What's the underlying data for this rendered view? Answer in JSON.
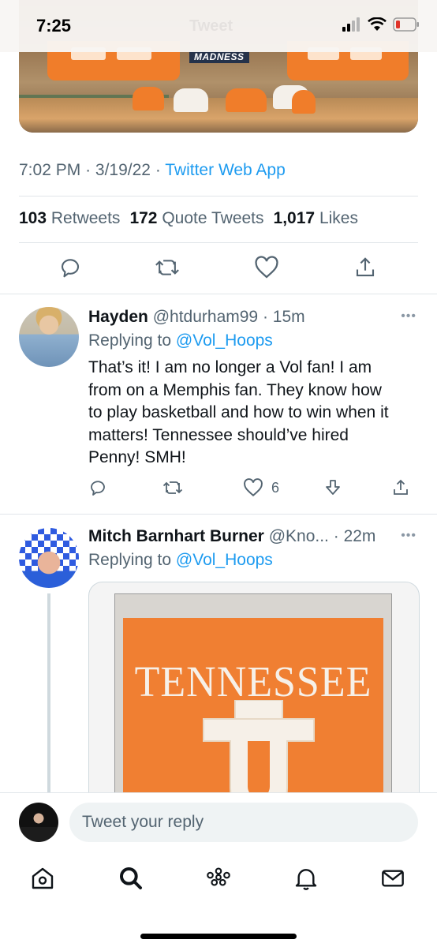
{
  "status_bar": {
    "time": "7:25",
    "ghost_title": "Tweet"
  },
  "media_top": {
    "badge": "MADNESS"
  },
  "tweet": {
    "time": "7:02 PM",
    "date": "3/19/22",
    "source": "Twitter Web App",
    "retweets_count": "103",
    "retweets_label": "Retweets",
    "quotes_count": "172",
    "quotes_label": "Quote Tweets",
    "likes_count": "1,017",
    "likes_label": "Likes"
  },
  "replies": [
    {
      "name": "Hayden",
      "handle": "@htdurham99",
      "time": "15m",
      "replying_prefix": "Replying to",
      "replying_to": "@Vol_Hoops",
      "text_lines": [
        "That’s it! I am no longer a Vol fan! I am",
        "from on a Memphis fan. They know how",
        "to play basketball and how to win when it",
        "matters! Tennessee should’ve hired",
        "Penny! SMH!"
      ],
      "likes": "6"
    },
    {
      "name": "Mitch Barnhart Burner",
      "handle": "@Kno...",
      "time": "22m",
      "replying_prefix": "Replying to",
      "replying_to": "@Vol_Hoops",
      "media_text": "TENNESSEE"
    }
  ],
  "compose": {
    "placeholder": "Tweet your reply"
  },
  "tabs": [
    "home-icon",
    "search-icon",
    "spaces-icon",
    "notifications-icon",
    "messages-icon"
  ],
  "colors": {
    "accent": "#1d9bf0",
    "secondary_text": "#536471",
    "tennessee_orange": "#f07f32"
  }
}
